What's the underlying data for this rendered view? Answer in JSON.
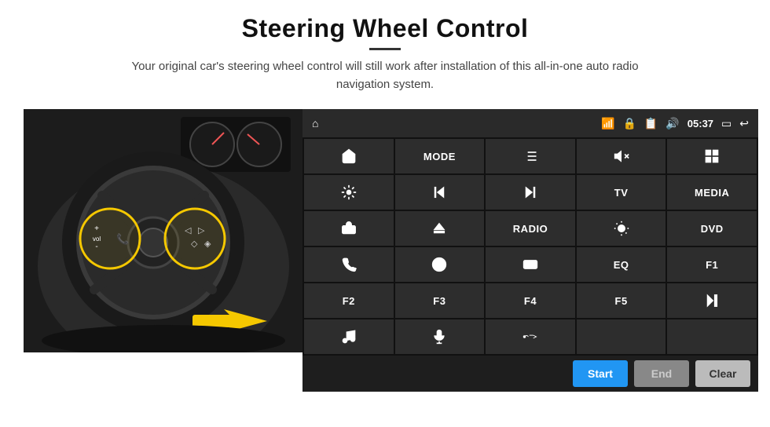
{
  "page": {
    "title": "Steering Wheel Control",
    "subtitle": "Your original car's steering wheel control will still work after installation of this all-in-one auto radio navigation system.",
    "divider": true
  },
  "status_bar": {
    "time": "05:37",
    "icons": [
      "wifi",
      "lock",
      "sim",
      "bluetooth",
      "tv",
      "back"
    ]
  },
  "button_grid": [
    [
      {
        "label": "",
        "icon": "home",
        "row": 1,
        "col": 1
      },
      {
        "label": "MODE",
        "icon": "",
        "row": 1,
        "col": 2
      },
      {
        "label": "",
        "icon": "list",
        "row": 1,
        "col": 3
      },
      {
        "label": "",
        "icon": "mute",
        "row": 1,
        "col": 4
      },
      {
        "label": "",
        "icon": "grid",
        "row": 1,
        "col": 5
      }
    ],
    [
      {
        "label": "",
        "icon": "settings-circle",
        "row": 2,
        "col": 1
      },
      {
        "label": "",
        "icon": "prev",
        "row": 2,
        "col": 2
      },
      {
        "label": "",
        "icon": "next",
        "row": 2,
        "col": 3
      },
      {
        "label": "TV",
        "icon": "",
        "row": 2,
        "col": 4
      },
      {
        "label": "MEDIA",
        "icon": "",
        "row": 2,
        "col": 5
      }
    ],
    [
      {
        "label": "",
        "icon": "360",
        "row": 3,
        "col": 1
      },
      {
        "label": "",
        "icon": "eject",
        "row": 3,
        "col": 2
      },
      {
        "label": "RADIO",
        "icon": "",
        "row": 3,
        "col": 3
      },
      {
        "label": "",
        "icon": "brightness",
        "row": 3,
        "col": 4
      },
      {
        "label": "DVD",
        "icon": "",
        "row": 3,
        "col": 5
      }
    ],
    [
      {
        "label": "",
        "icon": "phone",
        "row": 4,
        "col": 1
      },
      {
        "label": "",
        "icon": "spiral",
        "row": 4,
        "col": 2
      },
      {
        "label": "",
        "icon": "screen",
        "row": 4,
        "col": 3
      },
      {
        "label": "EQ",
        "icon": "",
        "row": 4,
        "col": 4
      },
      {
        "label": "F1",
        "icon": "",
        "row": 4,
        "col": 5
      }
    ],
    [
      {
        "label": "F2",
        "icon": "",
        "row": 5,
        "col": 1
      },
      {
        "label": "F3",
        "icon": "",
        "row": 5,
        "col": 2
      },
      {
        "label": "F4",
        "icon": "",
        "row": 5,
        "col": 3
      },
      {
        "label": "F5",
        "icon": "",
        "row": 5,
        "col": 4
      },
      {
        "label": "",
        "icon": "play-pause",
        "row": 5,
        "col": 5
      }
    ],
    [
      {
        "label": "",
        "icon": "music",
        "row": 6,
        "col": 1
      },
      {
        "label": "",
        "icon": "mic",
        "row": 6,
        "col": 2
      },
      {
        "label": "",
        "icon": "phone-end",
        "row": 6,
        "col": 3
      },
      {
        "label": "",
        "icon": "",
        "row": 6,
        "col": 4
      },
      {
        "label": "",
        "icon": "",
        "row": 6,
        "col": 5
      }
    ]
  ],
  "action_buttons": {
    "start": "Start",
    "end": "End",
    "clear": "Clear"
  }
}
